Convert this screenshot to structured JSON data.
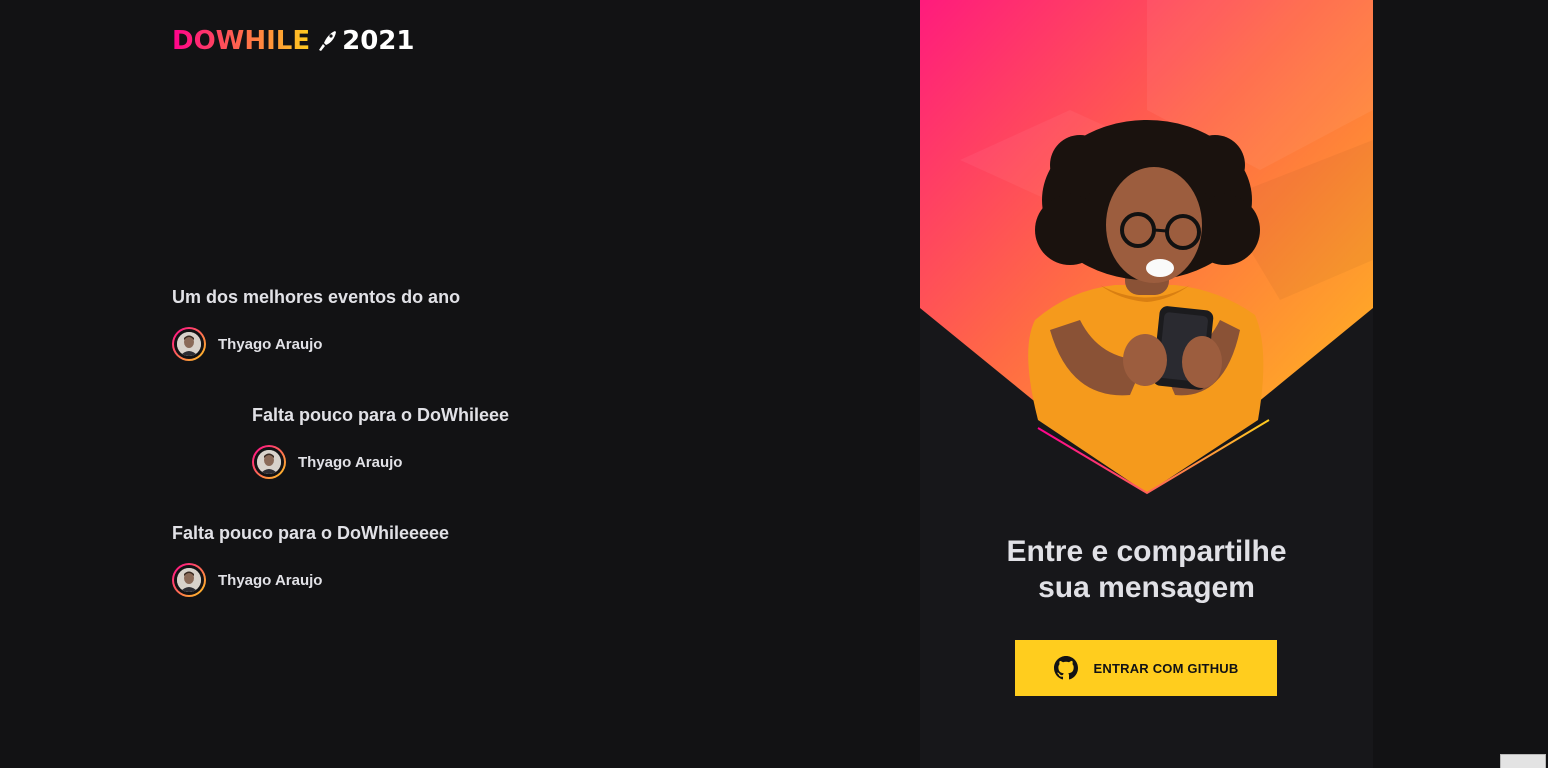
{
  "logo": {
    "brand": "DOWHILE",
    "year": "2021"
  },
  "messages": [
    {
      "content": "Um dos melhores eventos do ano",
      "user": "Thyago Araujo"
    },
    {
      "content": "Falta pouco para o DoWhileee",
      "user": "Thyago Araujo"
    },
    {
      "content": "Falta pouco para o DoWhileeeee",
      "user": "Thyago Araujo"
    }
  ],
  "login": {
    "title_line1": "Entre e compartilhe",
    "title_line2": "sua mensagem",
    "button_label": "ENTRAR COM GITHUB"
  },
  "colors": {
    "background": "#121214",
    "panel": "#17171a",
    "pink": "#ff008e",
    "yellow": "#ffcd1e",
    "text": "#e1e1e6"
  },
  "icons": {
    "logo_mark": "rocket-icon",
    "button_icon": "github-icon"
  }
}
